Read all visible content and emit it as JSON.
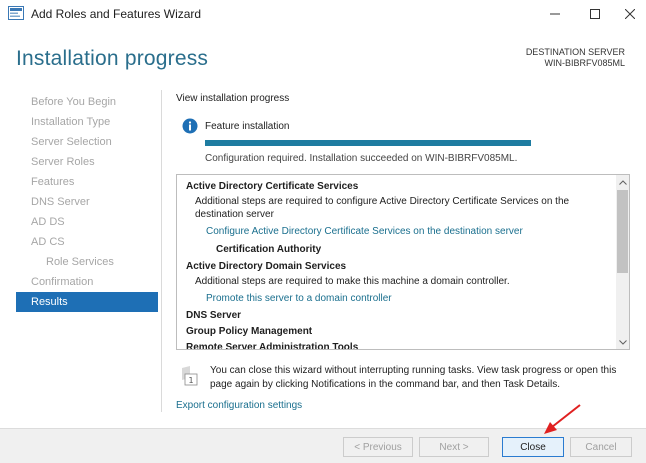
{
  "window": {
    "title": "Add Roles and Features Wizard",
    "icons": {
      "app": "server-manager-icon",
      "minimize": "minimize-icon",
      "maximize": "maximize-icon",
      "close": "close-icon"
    }
  },
  "header": {
    "page_title": "Installation progress",
    "destination_label": "DESTINATION SERVER",
    "destination_server": "WIN-BIBRFV085ML"
  },
  "sidebar": {
    "items": [
      {
        "label": "Before You Begin",
        "active": false
      },
      {
        "label": "Installation Type",
        "active": false
      },
      {
        "label": "Server Selection",
        "active": false
      },
      {
        "label": "Server Roles",
        "active": false
      },
      {
        "label": "Features",
        "active": false
      },
      {
        "label": "DNS Server",
        "active": false
      },
      {
        "label": "AD DS",
        "active": false
      },
      {
        "label": "AD CS",
        "active": false
      },
      {
        "label": "Role Services",
        "active": false
      },
      {
        "label": "Confirmation",
        "active": false
      },
      {
        "label": "Results",
        "active": true
      }
    ]
  },
  "main": {
    "heading": "View installation progress",
    "feature_title": "Feature installation",
    "progress_percent": 100,
    "status_text": "Configuration required. Installation succeeded on WIN-BIBRFV085ML.",
    "results": {
      "adcs_title": "Active Directory Certificate Services",
      "adcs_desc": "Additional steps are required to configure Active Directory Certificate Services on the destination server",
      "adcs_link": "Configure Active Directory Certificate Services on the destination server",
      "adcs_sub": "Certification Authority",
      "adds_title": "Active Directory Domain Services",
      "adds_desc": "Additional steps are required to make this machine a domain controller.",
      "adds_link": "Promote this server to a domain controller",
      "dns_title": "DNS Server",
      "gpm_title": "Group Policy Management",
      "rsat_title": "Remote Server Administration Tools"
    },
    "note": "You can close this wizard without interrupting running tasks. View task progress or open this page again by clicking Notifications in the command bar, and then Task Details.",
    "export_link": "Export configuration settings"
  },
  "footer": {
    "previous": "< Previous",
    "next": "Next >",
    "close": "Close",
    "cancel": "Cancel"
  },
  "colors": {
    "accent": "#1e6fb5",
    "title": "#2a6e8c",
    "progress": "#1e7ca1",
    "link": "#1a6f8e",
    "arrow": "#e02020"
  }
}
